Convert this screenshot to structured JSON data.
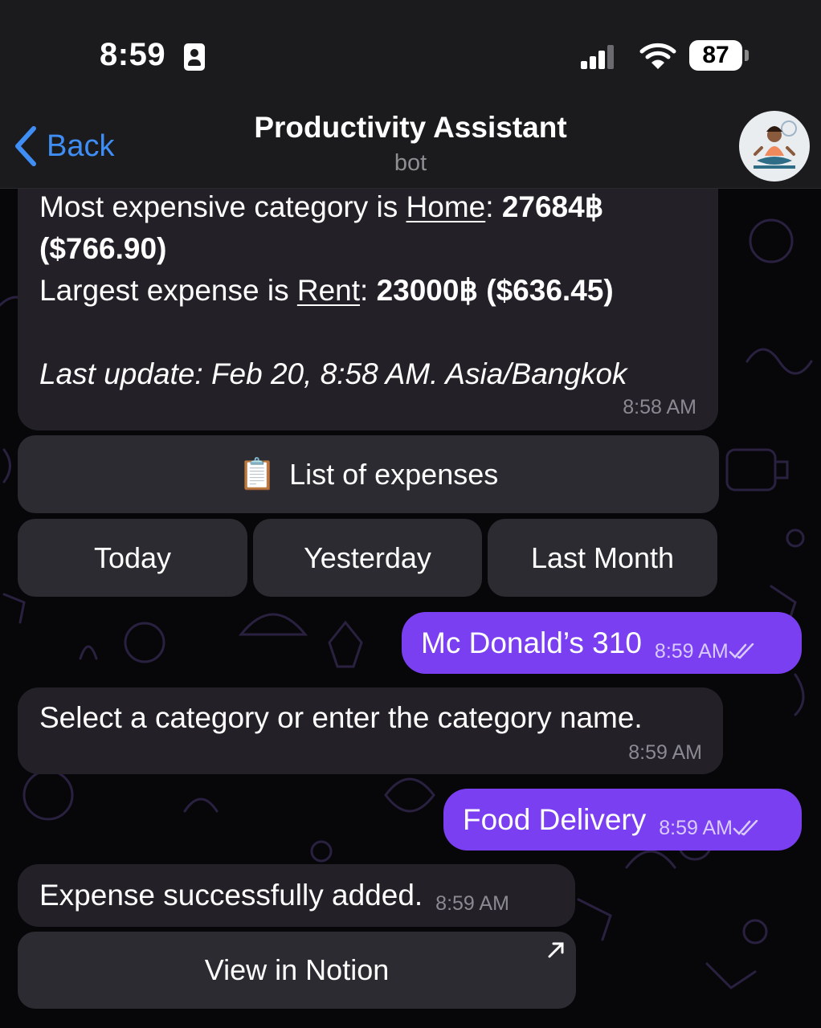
{
  "status_bar": {
    "time": "8:59",
    "battery": "87"
  },
  "header": {
    "back_label": "Back",
    "title": "Productivity Assistant",
    "subtitle": "bot"
  },
  "messages": {
    "summary": {
      "line1_prefix": "Most expensive category is ",
      "line1_link": "Home",
      "line1_sep": ": ",
      "line1_value": "27684฿ ($766.90)",
      "line2_prefix": "Largest expense is ",
      "line2_link": "Rent",
      "line2_sep": ": ",
      "line2_value": "23000฿ ($636.45)",
      "last_update": "Last update: Feb 20, 8:58 AM. Asia/Bangkok",
      "time": "8:58 AM"
    },
    "keyboard": {
      "list_label": "List of expenses",
      "list_icon": "📋",
      "today": "Today",
      "yesterday": "Yesterday",
      "last_month": "Last Month"
    },
    "out1": {
      "text": "Mc Donald’s 310",
      "time": "8:59 AM"
    },
    "select_prompt": {
      "text": "Select a category or enter the category name.",
      "time": "8:59 AM"
    },
    "out2": {
      "text": "Food Delivery",
      "time": "8:59 AM"
    },
    "added": {
      "text": "Expense successfully added.",
      "time": "8:59 AM"
    },
    "notion_button": "View in Notion"
  },
  "colors": {
    "accent": "#3f8ef5",
    "outgoing": "#7b3ff2",
    "incoming": "#232127"
  }
}
